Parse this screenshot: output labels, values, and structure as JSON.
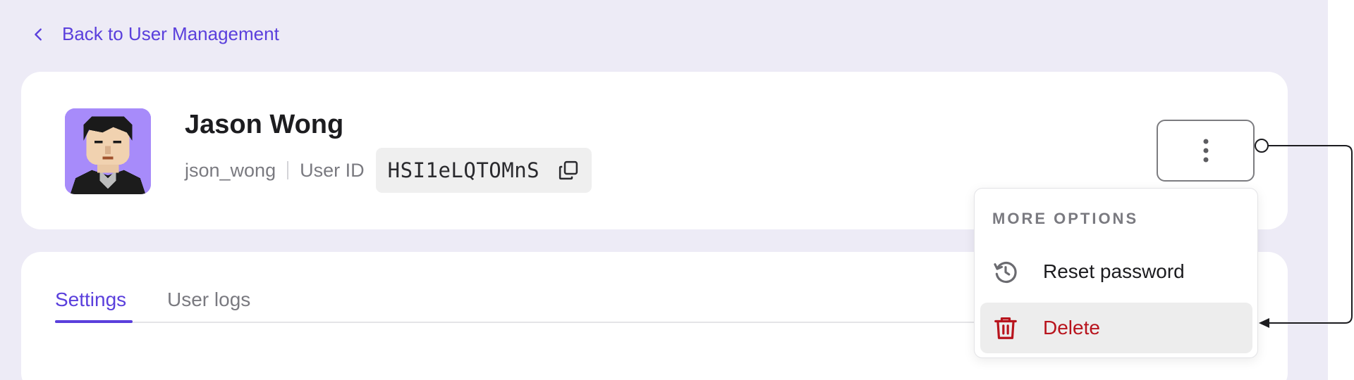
{
  "nav": {
    "back_label": "Back to User Management"
  },
  "user": {
    "name": "Jason Wong",
    "username": "json_wong",
    "user_id_label": "User ID",
    "user_id": "HSI1eLQTOMnS",
    "avatar_bg": "#a78bfa"
  },
  "tabs": [
    {
      "label": "Settings",
      "active": true
    },
    {
      "label": "User logs",
      "active": false
    }
  ],
  "menu": {
    "header": "MORE OPTIONS",
    "items": [
      {
        "label": "Reset password",
        "icon": "reset-password-icon"
      },
      {
        "label": "Delete",
        "icon": "trash-icon",
        "color": "#b8141d"
      }
    ]
  },
  "colors": {
    "accent": "#5a3fdc",
    "page_bg": "#edebf6",
    "danger": "#b8141d"
  }
}
